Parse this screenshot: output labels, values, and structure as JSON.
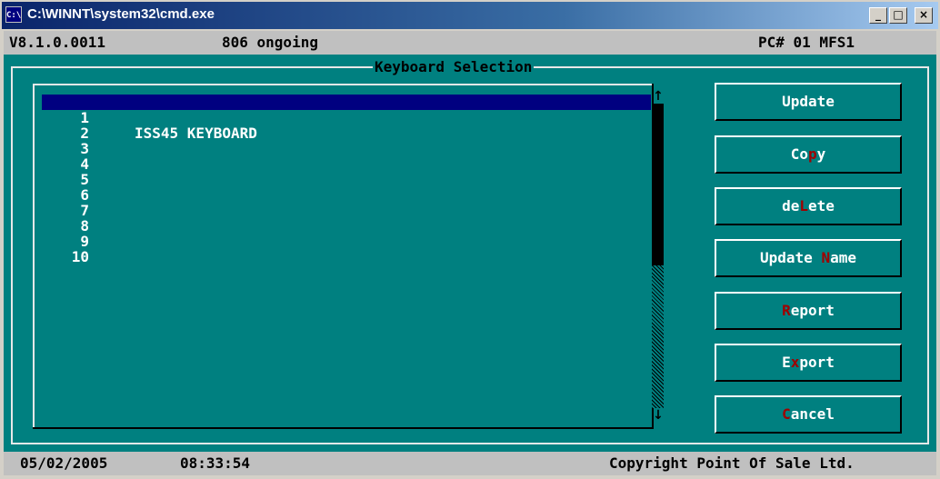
{
  "window": {
    "title": "C:\\WINNT\\system32\\cmd.exe",
    "icon_text": "C:\\",
    "controls": {
      "minimize": "_",
      "maximize": "□",
      "close": "×"
    }
  },
  "status_top": {
    "version": "V8.1.0.0011",
    "status": "806 ongoing",
    "pc": "PC# 01 MFS1"
  },
  "dialog": {
    "title": "Keyboard Selection"
  },
  "list": {
    "rows": [
      {
        "num": "1",
        "name": "ISS45 KEYBOARD"
      },
      {
        "num": "2",
        "name": ""
      },
      {
        "num": "3",
        "name": ""
      },
      {
        "num": "4",
        "name": ""
      },
      {
        "num": "5",
        "name": ""
      },
      {
        "num": "6",
        "name": ""
      },
      {
        "num": "7",
        "name": ""
      },
      {
        "num": "8",
        "name": ""
      },
      {
        "num": "9",
        "name": ""
      },
      {
        "num": "10",
        "name": ""
      }
    ],
    "scroll_up": "↑",
    "scroll_down": "↓"
  },
  "buttons": [
    {
      "id": "update",
      "pre": "Update",
      "hot": "",
      "post": ""
    },
    {
      "id": "copy",
      "pre": "Co",
      "hot": "p",
      "post": "y"
    },
    {
      "id": "delete",
      "pre": "de",
      "hot": "L",
      "post": "ete"
    },
    {
      "id": "update-name",
      "pre": "Update ",
      "hot": "N",
      "post": "ame"
    },
    {
      "id": "report",
      "pre": "",
      "hot": "R",
      "post": "eport"
    },
    {
      "id": "export",
      "pre": "E",
      "hot": "x",
      "post": "port"
    },
    {
      "id": "cancel",
      "pre": "",
      "hot": "C",
      "post": "ancel"
    }
  ],
  "status_bottom": {
    "date": "05/02/2005",
    "time": "08:33:54",
    "copyright": "Copyright Point Of Sale Ltd."
  },
  "colors": {
    "background": "#008080",
    "selection": "#000080",
    "hotkey": "#a00000",
    "statusbar": "#c0c0c0"
  }
}
